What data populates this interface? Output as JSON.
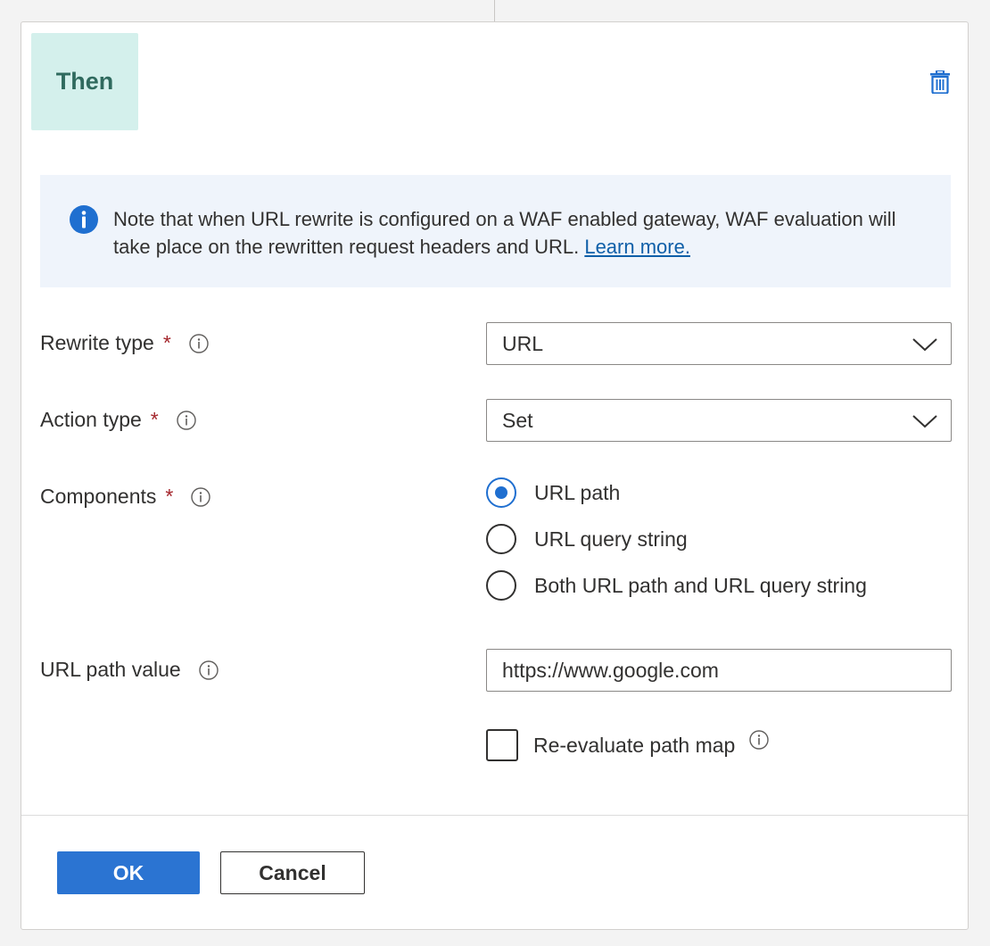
{
  "card": {
    "badge_label": "Then",
    "delete_icon": "trash-icon"
  },
  "info": {
    "icon": "info-icon",
    "text": "Note that when URL rewrite is configured on a WAF enabled gateway, WAF evaluation will take place on the rewritten request headers and URL.",
    "link_text": "Learn more."
  },
  "rewrite_type": {
    "label": "Rewrite type",
    "required_mark": "*",
    "value": "URL"
  },
  "action_type": {
    "label": "Action type",
    "required_mark": "*",
    "value": "Set"
  },
  "components": {
    "label": "Components",
    "required_mark": "*",
    "options": [
      {
        "label": "URL path",
        "selected": true
      },
      {
        "label": "URL query string",
        "selected": false
      },
      {
        "label": "Both URL path and URL query string",
        "selected": false
      }
    ]
  },
  "url_path_value": {
    "label": "URL path value",
    "value": "https://www.google.com"
  },
  "reevaluate": {
    "label": "Re-evaluate path map",
    "checked": false
  },
  "footer": {
    "ok_label": "OK",
    "cancel_label": "Cancel"
  },
  "colors": {
    "accent": "#2b74d2",
    "badge_bg": "#d4f0ec",
    "badge_text": "#2f6a5e",
    "info_bg": "#eff4fb",
    "required": "#a4262c"
  }
}
